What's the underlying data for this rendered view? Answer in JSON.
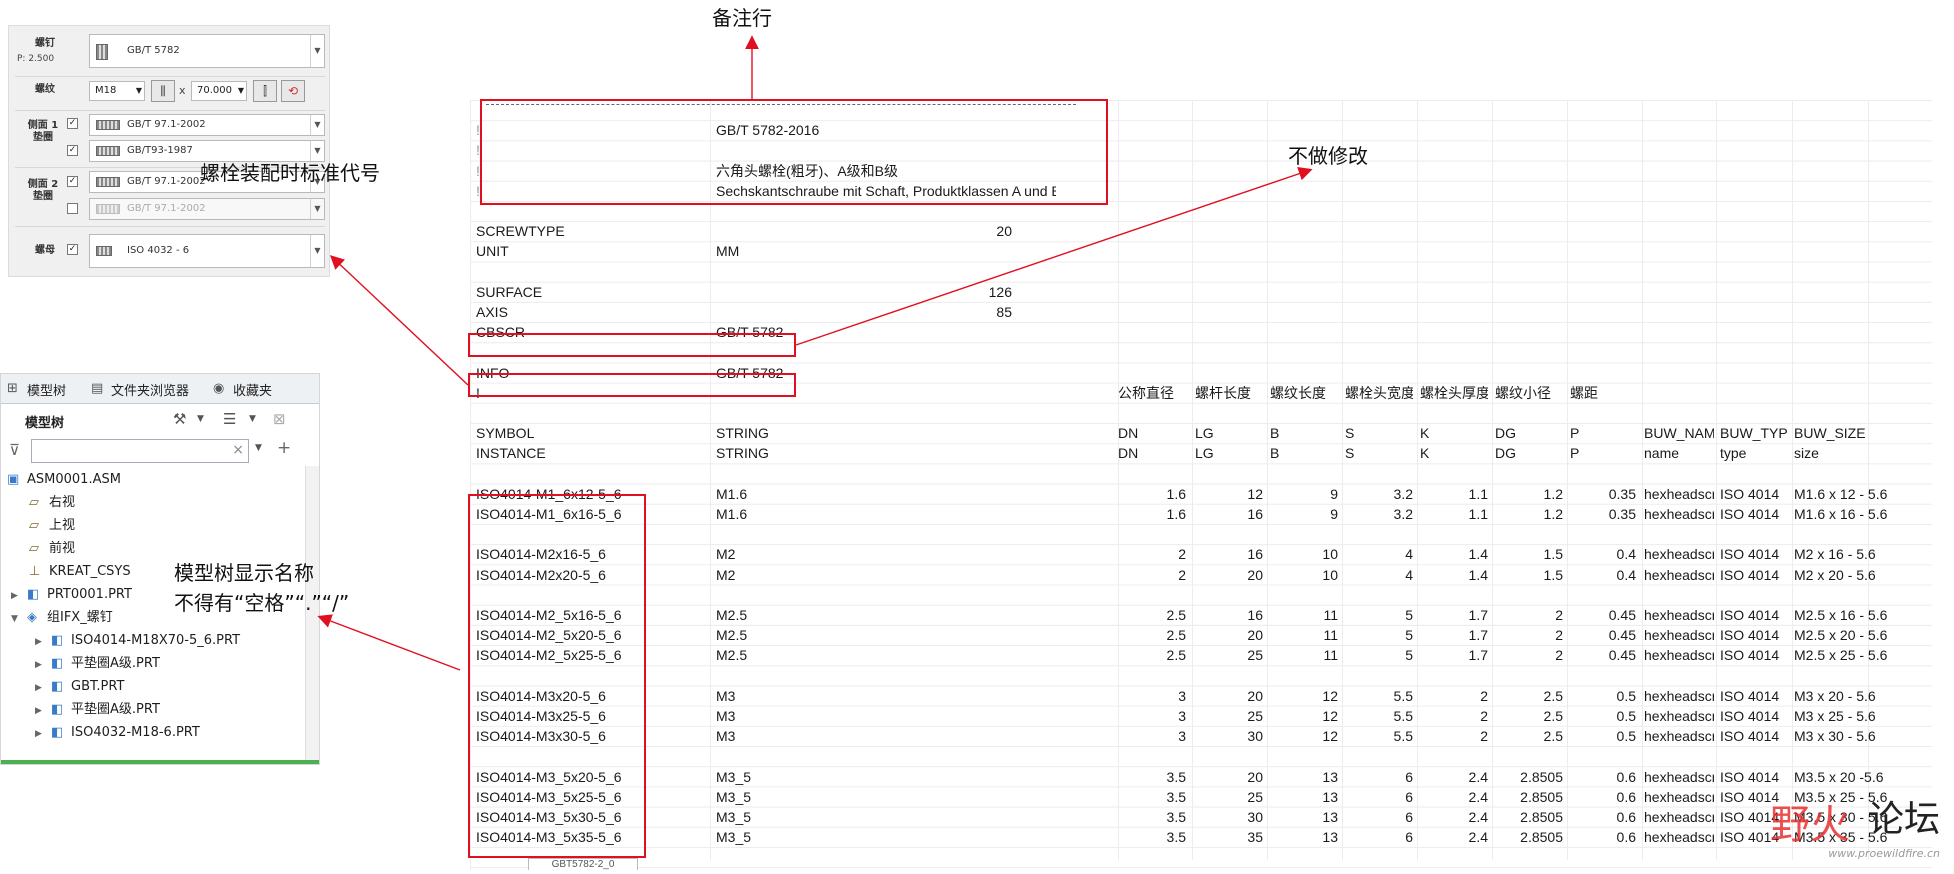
{
  "annotations": {
    "note_row": "备注行",
    "no_modify": "不做修改",
    "bolt_code": "螺栓装配时标准代号",
    "tree_name_line1": "模型树显示名称",
    "tree_name_line2": "不得有“空格”“.”“/”"
  },
  "fastener_dialog": {
    "screw_label": "螺钉",
    "pitch": "P: 2.500",
    "screw_standard": "GB/T 5782",
    "thread_label": "螺纹",
    "thread_size": "M18",
    "x": "x",
    "length": "70.000",
    "side1_label": "侧面 1\n垫圈",
    "side1_washer1": "GB/T 97.1-2002",
    "side1_washer2": "GB/T93-1987",
    "side2_label": "侧面 2\n垫圈",
    "side2_washer1": "GB/T 97.1-2002",
    "side2_washer2": "GB/T 97.1-2002",
    "nut_label": "螺母",
    "nut_standard": "ISO 4032 - 6"
  },
  "model_tree": {
    "tabs": [
      "模型树",
      "文件夹浏览器",
      "收藏夹"
    ],
    "title": "模型树",
    "items": [
      {
        "label": "ASM0001.ASM"
      },
      {
        "label": "右视"
      },
      {
        "label": "上视"
      },
      {
        "label": "前视"
      },
      {
        "label": "KREAT_CSYS"
      },
      {
        "label": "PRT0001.PRT"
      },
      {
        "label": "组IFX_螺钉"
      },
      {
        "label": "ISO4014-M18X70-5_6.PRT"
      },
      {
        "label": "平垫圈A级.PRT"
      },
      {
        "label": "GBT.PRT"
      },
      {
        "label": "平垫圈A级.PRT"
      },
      {
        "label": "ISO4032-M18-6.PRT"
      }
    ]
  },
  "sheet": {
    "header_block": {
      "standard": "GB/T 5782-2016",
      "name_cn": "六角头螺栓(粗牙)、A级和B级",
      "name_de": "Sechskantschraube mit Schaft, Produktklassen A und B"
    },
    "params": {
      "screwtype_key": "SCREWTYPE",
      "screwtype_val": "20",
      "unit_key": "UNIT",
      "unit_val": "MM",
      "surface_key": "SURFACE",
      "surface_val": "126",
      "axis_key": "AXIS",
      "axis_val": "85",
      "cbscr_key": "CBSCR",
      "cbscr_val": "GB/T 5782",
      "info_key": "INFO",
      "info_val": "GB/T 5782"
    },
    "comment_mark": "!",
    "cn_headers": [
      "公称直径",
      "螺杆长度",
      "螺纹长度",
      "螺栓头宽度",
      "螺栓头厚度",
      "螺纹小径",
      "螺距"
    ],
    "symbol_row": [
      "SYMBOL",
      "STRING",
      "DN",
      "LG",
      "B",
      "S",
      "K",
      "DG",
      "P",
      "BUW_NAME",
      "BUW_TYPE",
      "BUW_SIZE"
    ],
    "instance_row": [
      "INSTANCE",
      "STRING",
      "DN",
      "LG",
      "B",
      "S",
      "K",
      "DG",
      "P",
      "name",
      "type",
      "size"
    ],
    "rows": [
      {
        "inst": "ISO4014-M1_6x12-5_6",
        "str": "M1.6",
        "dn": "1.6",
        "lg": "12",
        "b": "9",
        "s": "3.2",
        "k": "1.1",
        "dg": "1.2",
        "p": "0.35",
        "name": "hexheadscrew",
        "type": "ISO 4014",
        "size": "M1.6 x 12 - 5.6"
      },
      {
        "inst": "ISO4014-M1_6x16-5_6",
        "str": "M1.6",
        "dn": "1.6",
        "lg": "16",
        "b": "9",
        "s": "3.2",
        "k": "1.1",
        "dg": "1.2",
        "p": "0.35",
        "name": "hexheadscrew",
        "type": "ISO 4014",
        "size": "M1.6 x 16 - 5.6"
      },
      {
        "inst": "ISO4014-M2x16-5_6",
        "str": "M2",
        "dn": "2",
        "lg": "16",
        "b": "10",
        "s": "4",
        "k": "1.4",
        "dg": "1.5",
        "p": "0.4",
        "name": "hexheadscrew",
        "type": "ISO 4014",
        "size": "M2 x 16 - 5.6"
      },
      {
        "inst": "ISO4014-M2x20-5_6",
        "str": "M2",
        "dn": "2",
        "lg": "20",
        "b": "10",
        "s": "4",
        "k": "1.4",
        "dg": "1.5",
        "p": "0.4",
        "name": "hexheadscrew",
        "type": "ISO 4014",
        "size": "M2 x 20 - 5.6"
      },
      {
        "inst": "ISO4014-M2_5x16-5_6",
        "str": "M2.5",
        "dn": "2.5",
        "lg": "16",
        "b": "11",
        "s": "5",
        "k": "1.7",
        "dg": "2",
        "p": "0.45",
        "name": "hexheadscrew",
        "type": "ISO 4014",
        "size": "M2.5 x 16 - 5.6"
      },
      {
        "inst": "ISO4014-M2_5x20-5_6",
        "str": "M2.5",
        "dn": "2.5",
        "lg": "20",
        "b": "11",
        "s": "5",
        "k": "1.7",
        "dg": "2",
        "p": "0.45",
        "name": "hexheadscrew",
        "type": "ISO 4014",
        "size": "M2.5 x 20 - 5.6"
      },
      {
        "inst": "ISO4014-M2_5x25-5_6",
        "str": "M2.5",
        "dn": "2.5",
        "lg": "25",
        "b": "11",
        "s": "5",
        "k": "1.7",
        "dg": "2",
        "p": "0.45",
        "name": "hexheadscrew",
        "type": "ISO 4014",
        "size": "M2.5 x 25 - 5.6"
      },
      {
        "inst": "ISO4014-M3x20-5_6",
        "str": "M3",
        "dn": "3",
        "lg": "20",
        "b": "12",
        "s": "5.5",
        "k": "2",
        "dg": "2.5",
        "p": "0.5",
        "name": "hexheadscrew",
        "type": "ISO 4014",
        "size": "M3 x 20 - 5.6"
      },
      {
        "inst": "ISO4014-M3x25-5_6",
        "str": "M3",
        "dn": "3",
        "lg": "25",
        "b": "12",
        "s": "5.5",
        "k": "2",
        "dg": "2.5",
        "p": "0.5",
        "name": "hexheadscrew",
        "type": "ISO 4014",
        "size": "M3 x 25 - 5.6"
      },
      {
        "inst": "ISO4014-M3x30-5_6",
        "str": "M3",
        "dn": "3",
        "lg": "30",
        "b": "12",
        "s": "5.5",
        "k": "2",
        "dg": "2.5",
        "p": "0.5",
        "name": "hexheadscrew",
        "type": "ISO 4014",
        "size": "M3 x 30 - 5.6"
      },
      {
        "inst": "ISO4014-M3_5x20-5_6",
        "str": "M3_5",
        "dn": "3.5",
        "lg": "20",
        "b": "13",
        "s": "6",
        "k": "2.4",
        "dg": "2.8505",
        "p": "0.6",
        "name": "hexheadscrew",
        "type": "ISO 4014",
        "size": "M3.5 x 20 -5.6"
      },
      {
        "inst": "ISO4014-M3_5x25-5_6",
        "str": "M3_5",
        "dn": "3.5",
        "lg": "25",
        "b": "13",
        "s": "6",
        "k": "2.4",
        "dg": "2.8505",
        "p": "0.6",
        "name": "hexheadscrew",
        "type": "ISO 4014",
        "size": "M3.5 x 25 - 5.6"
      },
      {
        "inst": "ISO4014-M3_5x30-5_6",
        "str": "M3_5",
        "dn": "3.5",
        "lg": "30",
        "b": "13",
        "s": "6",
        "k": "2.4",
        "dg": "2.8505",
        "p": "0.6",
        "name": "hexheadscrew",
        "type": "ISO 4014",
        "size": "M3.5 x 30 - 5.6"
      },
      {
        "inst": "ISO4014-M3_5x35-5_6",
        "str": "M3_5",
        "dn": "3.5",
        "lg": "35",
        "b": "13",
        "s": "6",
        "k": "2.4",
        "dg": "2.8505",
        "p": "0.6",
        "name": "hexheadscrew",
        "type": "ISO 4014",
        "size": "M3.5 x 35 - 5.6"
      }
    ],
    "sheet_tab": "GBT5782-2_0"
  },
  "watermark": {
    "mark": "野火",
    "text": "论坛",
    "url": "www.proewildfire.cn"
  },
  "colors": {
    "annotation_red": "#e01020",
    "tree_accent": "#4caf50"
  }
}
